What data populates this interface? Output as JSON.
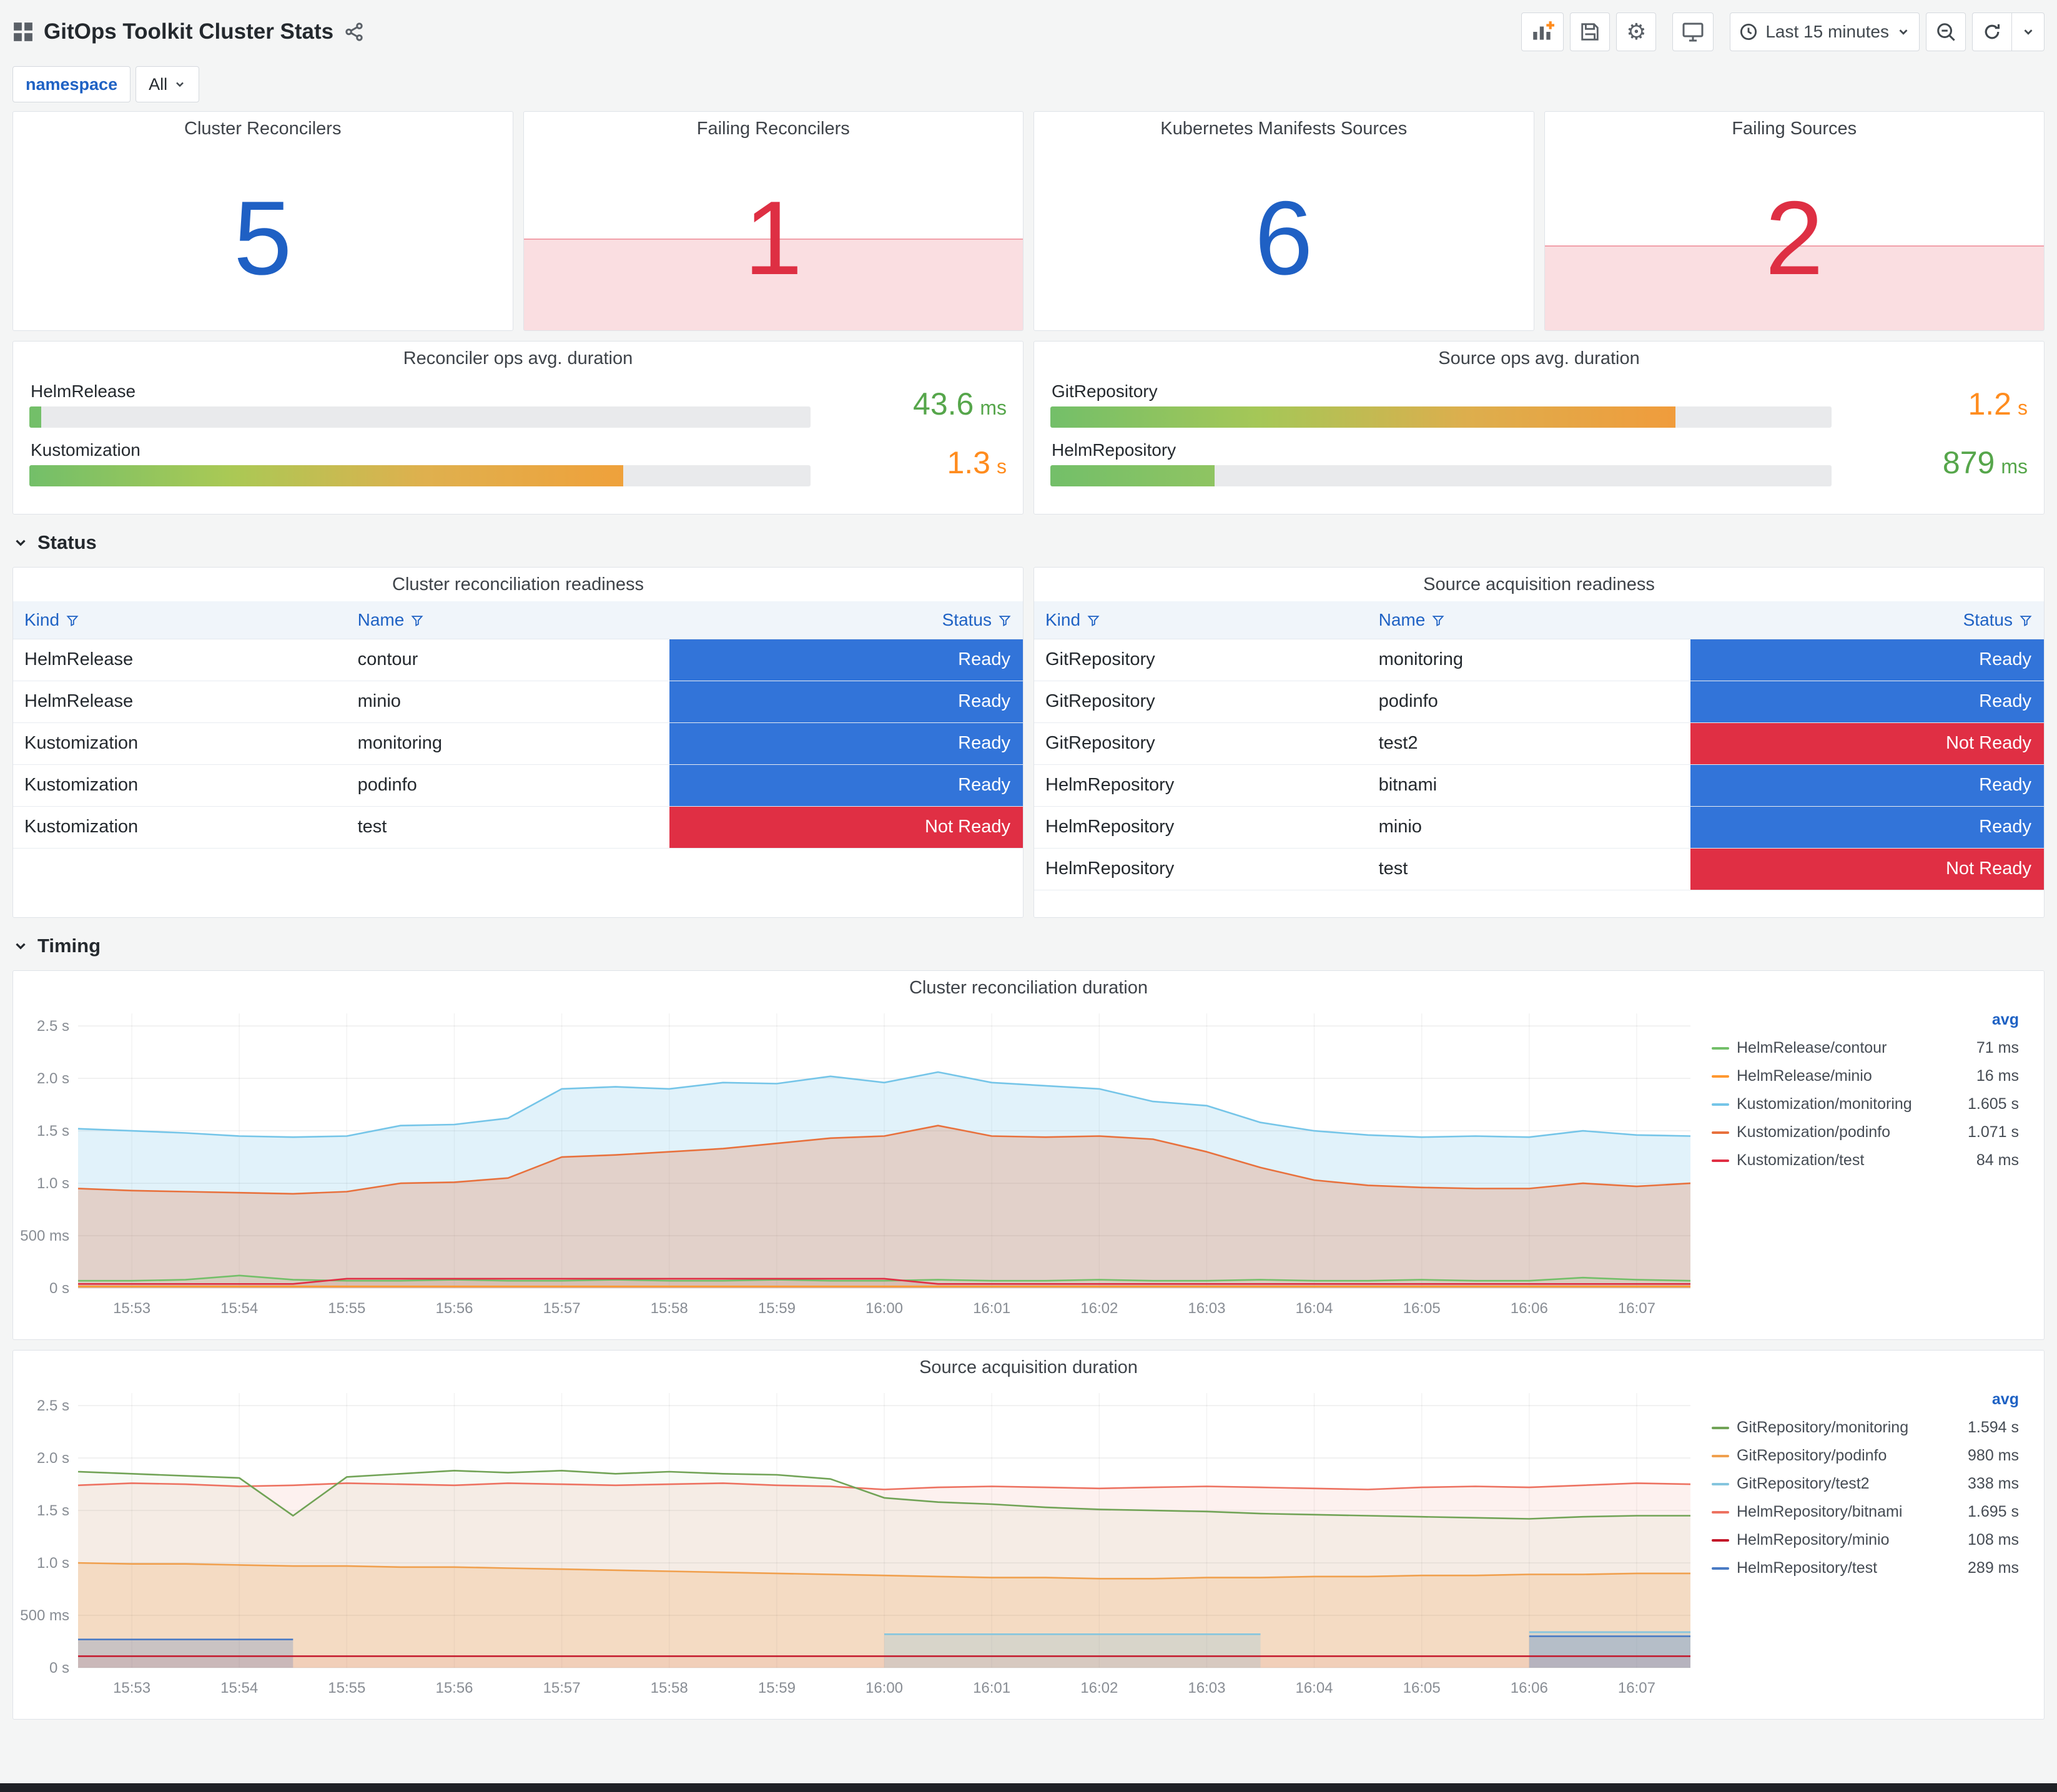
{
  "colors": {
    "stat_blue": "#1F60C4",
    "stat_red": "#DE2F43",
    "ready_bg": "#3274D9",
    "not_ready_bg": "#E02F44",
    "link_blue": "#1F62C4"
  },
  "header": {
    "title": "GitOps Toolkit Cluster Stats",
    "time_picker_label": "Last 15 minutes"
  },
  "filters": {
    "namespace": {
      "label": "namespace",
      "value": "All"
    }
  },
  "stat_panels": [
    {
      "title": "Cluster Reconcilers",
      "value": "5",
      "state": "ok"
    },
    {
      "title": "Failing Reconcilers",
      "value": "1",
      "state": "alert",
      "spark_fill_pct": 42
    },
    {
      "title": "Kubernetes Manifests Sources",
      "value": "6",
      "state": "ok"
    },
    {
      "title": "Failing Sources",
      "value": "2",
      "state": "alert",
      "spark_fill_pct": 39
    }
  ],
  "gauge_panels": [
    {
      "title": "Reconciler ops avg. duration",
      "rows": [
        {
          "label": "HelmRelease",
          "value": "43.6",
          "unit": "ms",
          "pct": 1.5,
          "value_color": "#56A64B",
          "bar_colors": [
            "#73BF69"
          ]
        },
        {
          "label": "Kustomization",
          "value": "1.3",
          "unit": "s",
          "pct": 76,
          "value_color": "#FF8C1E",
          "bar_colors": [
            "#73BF69",
            "#A9C955",
            "#DFB04E",
            "#EFA13B"
          ]
        }
      ]
    },
    {
      "title": "Source ops avg. duration",
      "rows": [
        {
          "label": "GitRepository",
          "value": "1.2",
          "unit": "s",
          "pct": 80,
          "value_color": "#FF8C1E",
          "bar_colors": [
            "#73BF69",
            "#A5C757",
            "#DDAE4D",
            "#F09C3C"
          ]
        },
        {
          "label": "HelmRepository",
          "value": "879",
          "unit": "ms",
          "pct": 21,
          "value_color": "#56A64B",
          "bar_colors": [
            "#73BF69",
            "#8FC462"
          ]
        }
      ]
    }
  ],
  "sections": {
    "status": "Status",
    "timing": "Timing"
  },
  "status_tables": [
    {
      "title": "Cluster reconciliation readiness",
      "columns": [
        "Kind",
        "Name",
        "Status"
      ],
      "rows": [
        {
          "kind": "HelmRelease",
          "name": "contour",
          "status": "Ready"
        },
        {
          "kind": "HelmRelease",
          "name": "minio",
          "status": "Ready"
        },
        {
          "kind": "Kustomization",
          "name": "monitoring",
          "status": "Ready"
        },
        {
          "kind": "Kustomization",
          "name": "podinfo",
          "status": "Ready"
        },
        {
          "kind": "Kustomization",
          "name": "test",
          "status": "Not Ready"
        }
      ]
    },
    {
      "title": "Source acquisition readiness",
      "columns": [
        "Kind",
        "Name",
        "Status"
      ],
      "rows": [
        {
          "kind": "GitRepository",
          "name": "monitoring",
          "status": "Ready"
        },
        {
          "kind": "GitRepository",
          "name": "podinfo",
          "status": "Ready"
        },
        {
          "kind": "GitRepository",
          "name": "test2",
          "status": "Not Ready"
        },
        {
          "kind": "HelmRepository",
          "name": "bitnami",
          "status": "Ready"
        },
        {
          "kind": "HelmRepository",
          "name": "minio",
          "status": "Ready"
        },
        {
          "kind": "HelmRepository",
          "name": "test",
          "status": "Not Ready"
        }
      ]
    }
  ],
  "chart_data": [
    {
      "type": "line",
      "title": "Cluster reconciliation duration",
      "legend_header": "avg",
      "legend_position": "right",
      "grid": true,
      "ylim": [
        0,
        2.62
      ],
      "yticks": [
        "0 s",
        "500 ms",
        "1.0 s",
        "1.5 s",
        "2.0 s",
        "2.5 s"
      ],
      "ytick_values": [
        0,
        0.5,
        1.0,
        1.5,
        2.0,
        2.5
      ],
      "xticks": [
        "15:53",
        "15:54",
        "15:55",
        "15:56",
        "15:57",
        "15:58",
        "15:59",
        "16:00",
        "16:01",
        "16:02",
        "16:03",
        "16:04",
        "16:05",
        "16:06",
        "16:07"
      ],
      "xtick_offset": 0.5,
      "x_span": 15,
      "series": [
        {
          "name": "HelmRelease/contour",
          "avg": "71 ms",
          "color": "#73BF69",
          "fill_opacity": 0.1,
          "values": [
            0.07,
            0.07,
            0.08,
            0.12,
            0.08,
            0.07,
            0.07,
            0.08,
            0.07,
            0.07,
            0.08,
            0.07,
            0.07,
            0.08,
            0.07,
            0.07,
            0.08,
            0.07,
            0.07,
            0.08,
            0.07,
            0.07,
            0.08,
            0.07,
            0.07,
            0.08,
            0.07,
            0.07,
            0.1,
            0.08,
            0.07
          ]
        },
        {
          "name": "HelmRelease/minio",
          "avg": "16 ms",
          "color": "#FF9830",
          "fill_opacity": 0.1,
          "values": [
            0.016,
            0.016,
            0.016,
            0.016,
            0.016,
            0.016,
            0.016,
            0.016,
            0.016,
            0.016,
            0.016,
            0.016,
            0.016,
            0.016,
            0.016,
            0.016,
            0.016,
            0.016,
            0.016,
            0.016,
            0.016,
            0.016,
            0.016,
            0.016,
            0.016,
            0.016,
            0.016,
            0.016,
            0.016,
            0.016,
            0.016
          ]
        },
        {
          "name": "Kustomization/monitoring",
          "avg": "1.605 s",
          "color": "#75C5E8",
          "fill_opacity": 0.22,
          "values": [
            1.52,
            1.5,
            1.48,
            1.45,
            1.44,
            1.45,
            1.55,
            1.56,
            1.62,
            1.9,
            1.92,
            1.9,
            1.96,
            1.95,
            2.02,
            1.96,
            2.06,
            1.96,
            1.93,
            1.9,
            1.78,
            1.74,
            1.58,
            1.5,
            1.46,
            1.44,
            1.45,
            1.44,
            1.5,
            1.46,
            1.45
          ]
        },
        {
          "name": "Kustomization/podinfo",
          "avg": "1.071 s",
          "color": "#E8713D",
          "fill_opacity": 0.25,
          "values": [
            0.95,
            0.93,
            0.92,
            0.91,
            0.9,
            0.92,
            1.0,
            1.01,
            1.05,
            1.25,
            1.27,
            1.3,
            1.33,
            1.38,
            1.43,
            1.45,
            1.55,
            1.45,
            1.44,
            1.45,
            1.42,
            1.3,
            1.15,
            1.03,
            0.98,
            0.96,
            0.95,
            0.95,
            1.0,
            0.97,
            1.0
          ]
        },
        {
          "name": "Kustomization/test",
          "avg": "84 ms",
          "color": "#E02F44",
          "fill_opacity": 0.1,
          "values": [
            0.04,
            0.04,
            0.04,
            0.04,
            0.04,
            0.09,
            0.09,
            0.09,
            0.09,
            0.09,
            0.09,
            0.09,
            0.09,
            0.09,
            0.09,
            0.09,
            0.04,
            0.04,
            0.04,
            0.04,
            0.04,
            0.04,
            0.04,
            0.04,
            0.04,
            0.04,
            0.04,
            0.04,
            0.04,
            0.04,
            0.04
          ]
        }
      ]
    },
    {
      "type": "line",
      "title": "Source acquisition duration",
      "legend_header": "avg",
      "legend_position": "right",
      "grid": true,
      "ylim": [
        0,
        2.62
      ],
      "yticks": [
        "0 s",
        "500 ms",
        "1.0 s",
        "1.5 s",
        "2.0 s",
        "2.5 s"
      ],
      "ytick_values": [
        0,
        0.5,
        1.0,
        1.5,
        2.0,
        2.5
      ],
      "xticks": [
        "15:53",
        "15:54",
        "15:55",
        "15:56",
        "15:57",
        "15:58",
        "15:59",
        "16:00",
        "16:01",
        "16:02",
        "16:03",
        "16:04",
        "16:05",
        "16:06",
        "16:07"
      ],
      "xtick_offset": 0.5,
      "x_span": 15,
      "series": [
        {
          "name": "GitRepository/monitoring",
          "avg": "1.594 s",
          "color": "#71A356",
          "fill_opacity": 0.06,
          "values": [
            1.87,
            1.85,
            1.83,
            1.81,
            1.45,
            1.82,
            1.85,
            1.88,
            1.86,
            1.88,
            1.85,
            1.87,
            1.85,
            1.84,
            1.8,
            1.62,
            1.58,
            1.56,
            1.53,
            1.51,
            1.5,
            1.49,
            1.47,
            1.46,
            1.45,
            1.44,
            1.43,
            1.42,
            1.44,
            1.45,
            1.45
          ]
        },
        {
          "name": "GitRepository/podinfo",
          "avg": "980 ms",
          "color": "#F0A04E",
          "fill_opacity": 0.22,
          "values": [
            1.0,
            0.99,
            0.99,
            0.98,
            0.97,
            0.97,
            0.96,
            0.96,
            0.95,
            0.94,
            0.93,
            0.92,
            0.91,
            0.9,
            0.89,
            0.88,
            0.87,
            0.86,
            0.86,
            0.85,
            0.85,
            0.86,
            0.86,
            0.87,
            0.87,
            0.88,
            0.88,
            0.89,
            0.89,
            0.9,
            0.9
          ]
        },
        {
          "name": "GitRepository/test2",
          "avg": "338 ms",
          "color": "#85C5DE",
          "fill_opacity": 0.25,
          "values": [
            null,
            null,
            null,
            null,
            null,
            null,
            null,
            null,
            null,
            null,
            null,
            null,
            null,
            null,
            null,
            0.32,
            0.32,
            0.32,
            0.32,
            0.32,
            0.32,
            0.32,
            0.32,
            null,
            null,
            null,
            null,
            0.34,
            0.34,
            0.34,
            0.34
          ]
        },
        {
          "name": "HelmRepository/bitnami",
          "avg": "1.695 s",
          "color": "#ED7261",
          "fill_opacity": 0.1,
          "values": [
            1.74,
            1.76,
            1.75,
            1.73,
            1.74,
            1.76,
            1.75,
            1.74,
            1.76,
            1.75,
            1.74,
            1.75,
            1.76,
            1.74,
            1.73,
            1.7,
            1.72,
            1.73,
            1.72,
            1.71,
            1.72,
            1.73,
            1.72,
            1.71,
            1.7,
            1.72,
            1.73,
            1.72,
            1.74,
            1.76,
            1.75
          ]
        },
        {
          "name": "HelmRepository/minio",
          "avg": "108 ms",
          "color": "#C4162A",
          "fill_opacity": 0.06,
          "values": [
            0.11,
            0.11,
            0.11,
            0.11,
            0.11,
            0.11,
            0.11,
            0.11,
            0.11,
            0.11,
            0.11,
            0.11,
            0.11,
            0.11,
            0.11,
            0.11,
            0.11,
            0.11,
            0.11,
            0.11,
            0.11,
            0.11,
            0.11,
            0.11,
            0.11,
            0.11,
            0.11,
            0.11,
            0.11,
            0.11,
            0.11
          ]
        },
        {
          "name": "HelmRepository/test",
          "avg": "289 ms",
          "color": "#4A7BC4",
          "fill_opacity": 0.25,
          "values": [
            0.27,
            0.27,
            0.27,
            0.27,
            0.27,
            null,
            null,
            null,
            null,
            null,
            null,
            null,
            null,
            null,
            null,
            null,
            null,
            null,
            null,
            null,
            null,
            null,
            null,
            null,
            null,
            null,
            null,
            0.3,
            0.3,
            0.3,
            0.3
          ]
        }
      ]
    }
  ]
}
